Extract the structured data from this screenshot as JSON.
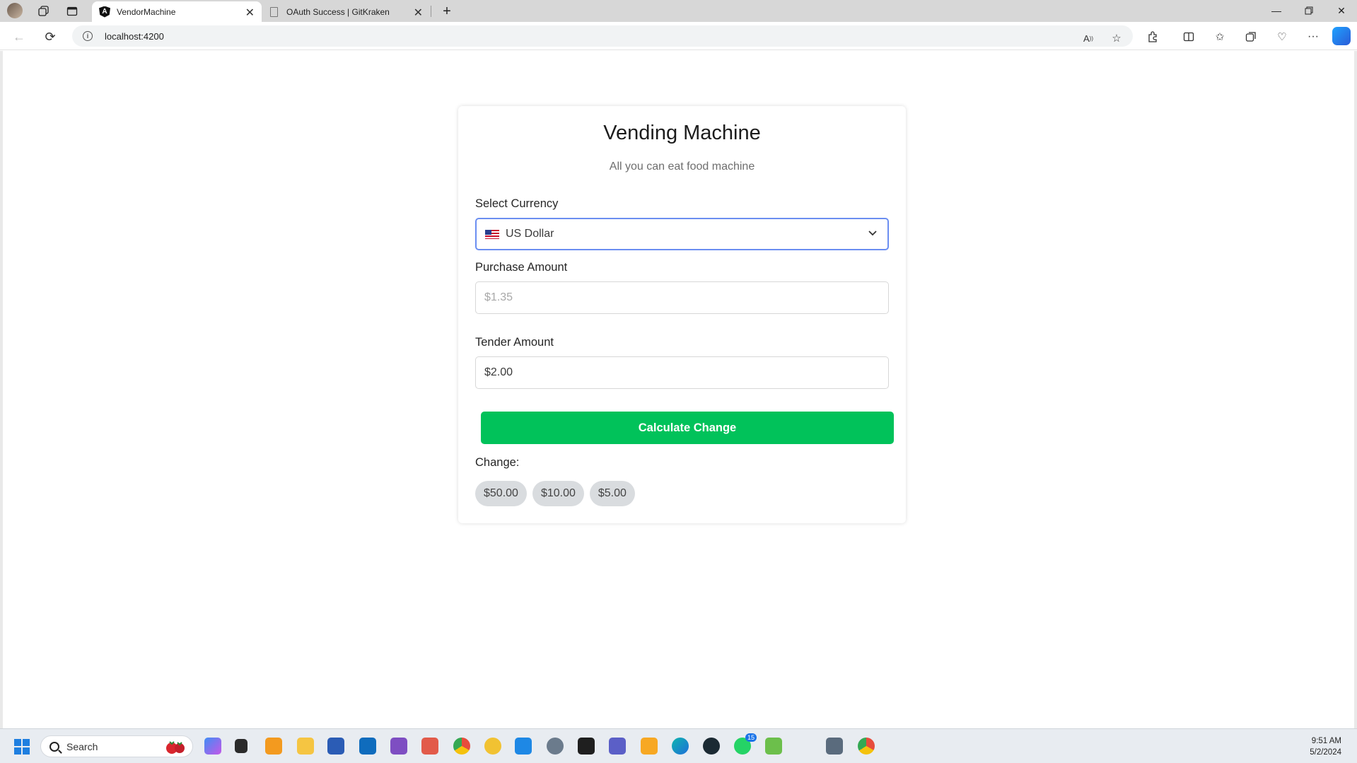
{
  "browser": {
    "tabs": [
      {
        "title": "VendorMachine",
        "active": true
      },
      {
        "title": "OAuth Success | GitKraken",
        "active": false
      }
    ],
    "url": "localhost:4200"
  },
  "page": {
    "title": "Vending Machine",
    "subtitle": "All you can eat food machine",
    "currency": {
      "label": "Select Currency",
      "selected": "US Dollar"
    },
    "purchase": {
      "label": "Purchase Amount",
      "placeholder": "$1.35"
    },
    "tender": {
      "label": "Tender Amount",
      "value": "$2.00"
    },
    "calculate_label": "Calculate Change",
    "change": {
      "label": "Change:",
      "items": [
        "$50.00",
        "$10.00",
        "$5.00"
      ]
    },
    "accent_color": "#01c25a"
  },
  "taskbar": {
    "search_placeholder": "Search",
    "time": "9:51 AM",
    "date": "5/2/2024",
    "badges": {
      "whatsapp": "15"
    }
  }
}
